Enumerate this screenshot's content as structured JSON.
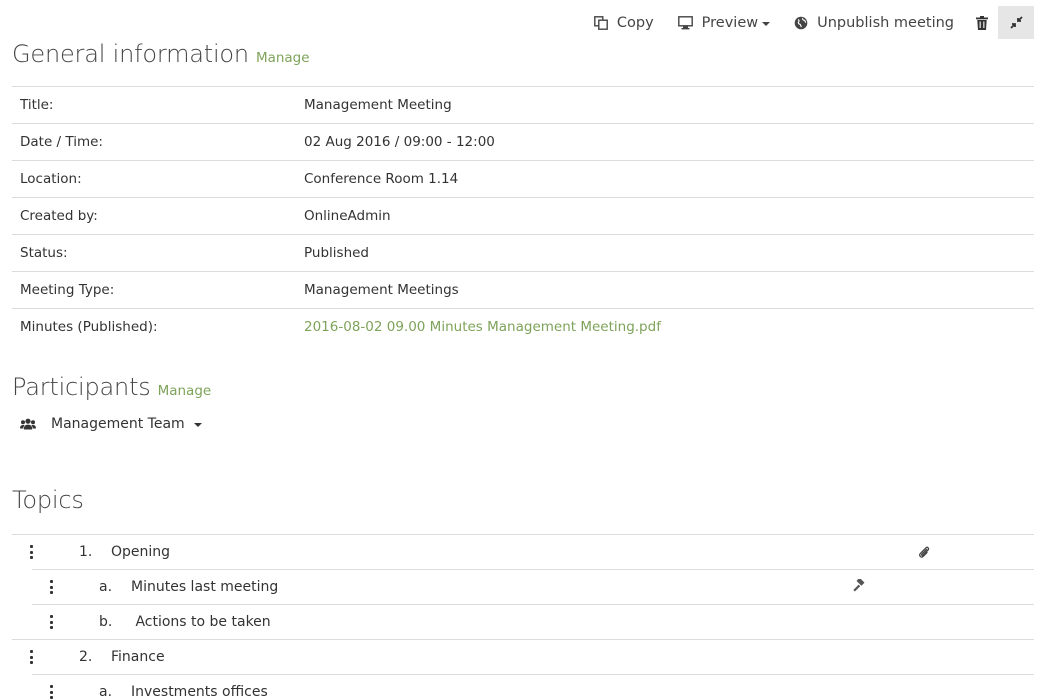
{
  "toolbar": {
    "copy_label": "Copy",
    "preview_label": "Preview",
    "unpublish_label": "Unpublish meeting",
    "icons": [
      "copy-icon",
      "monitor-icon",
      "globe-icon",
      "trash-icon",
      "collapse-icon"
    ]
  },
  "general": {
    "title": "General information",
    "manage": "Manage",
    "rows": [
      {
        "label": "Title:",
        "value": "Management Meeting"
      },
      {
        "label": "Date / Time:",
        "value": "02 Aug 2016 / 09:00 - 12:00"
      },
      {
        "label": "Location:",
        "value": "Conference Room 1.14"
      },
      {
        "label": "Created by:",
        "value": "OnlineAdmin"
      },
      {
        "label": "Status:",
        "value": "Published"
      },
      {
        "label": "Meeting Type:",
        "value": "Management Meetings"
      },
      {
        "label": "Minutes (Published):",
        "value": "2016-08-02 09.00 Minutes Management Meeting.pdf"
      }
    ]
  },
  "participants": {
    "title": "Participants",
    "manage": "Manage",
    "group": "Management Team"
  },
  "topics": {
    "title": "Topics",
    "items": [
      {
        "num": "1.",
        "title": "Opening",
        "level": 0,
        "icon": "paperclip-icon"
      },
      {
        "num": "a.",
        "title": "Minutes last meeting",
        "level": 1,
        "icon": "gavel-icon"
      },
      {
        "num": "b.",
        "title": " Actions to be taken",
        "level": 1,
        "icon": ""
      },
      {
        "num": "2.",
        "title": "Finance",
        "level": 0,
        "icon": ""
      },
      {
        "num": "a.",
        "title": "Investments offices",
        "level": 1,
        "icon": ""
      }
    ]
  },
  "colors": {
    "link": "#7ea35a",
    "border": "#dcdcdc",
    "active_button": "#e6e6e6"
  }
}
